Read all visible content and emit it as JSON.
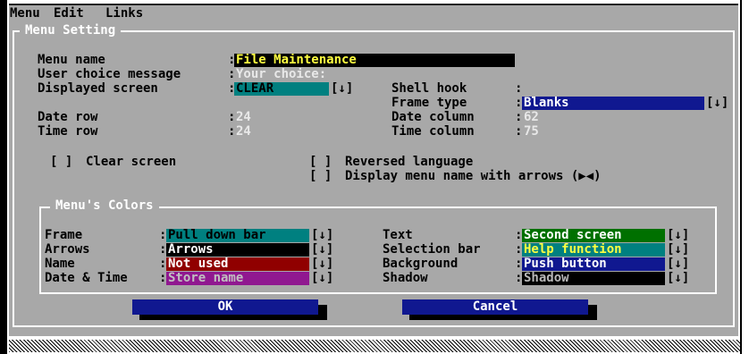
{
  "menu": {
    "items": [
      "Menu",
      "Edit",
      "Links"
    ]
  },
  "menu_setting": {
    "title": "Menu Setting",
    "menu_name": {
      "label": "Menu name",
      "value": "File Maintenance"
    },
    "user_choice": {
      "label": "User choice message",
      "value": "Your choice:"
    },
    "displayed_screen": {
      "label": "Displayed screen",
      "value": "CLEAR"
    },
    "shell_hook": {
      "label": "Shell hook",
      "value": ""
    },
    "frame_type": {
      "label": "Frame type",
      "value": "Blanks"
    },
    "date_row": {
      "label": "Date row",
      "value": "24"
    },
    "date_column": {
      "label": "Date column",
      "value": "62"
    },
    "time_row": {
      "label": "Time row",
      "value": "24"
    },
    "time_column": {
      "label": "Time column",
      "value": "75"
    },
    "clear_screen": {
      "box": "[ ]",
      "label": "Clear screen"
    },
    "reversed_language": {
      "box": "[ ]",
      "label": "Reversed language"
    },
    "display_arrows": {
      "box": "[ ]",
      "label": "Display menu name with arrows (▶◀)"
    }
  },
  "colors_section": {
    "title": "Menu's Colors",
    "frame": {
      "label": "Frame",
      "value": "Pull down bar"
    },
    "arrows": {
      "label": "Arrows",
      "value": "Arrows"
    },
    "name": {
      "label": "Name",
      "value": "Not used"
    },
    "date_time": {
      "label": "Date & Time",
      "value": "Store name"
    },
    "text": {
      "label": "Text",
      "value": "Second screen"
    },
    "selection_bar": {
      "label": "Selection bar",
      "value": "Help function"
    },
    "background": {
      "label": "Background",
      "value": "Push button"
    },
    "shadow": {
      "label": "Shadow",
      "value": "Shadow"
    }
  },
  "buttons": {
    "ok": "OK",
    "cancel": "Cancel"
  },
  "glyphs": {
    "sep": ":",
    "dropdown": "[↓]"
  },
  "palette": {
    "dialog_bg": "#a8a8a8",
    "field_black": "#000000",
    "field_teal": "#008080",
    "field_navy": "#101890",
    "field_green": "#007000",
    "field_red": "#900000",
    "field_purple": "#901890",
    "text_yellow": "#ffff40"
  }
}
